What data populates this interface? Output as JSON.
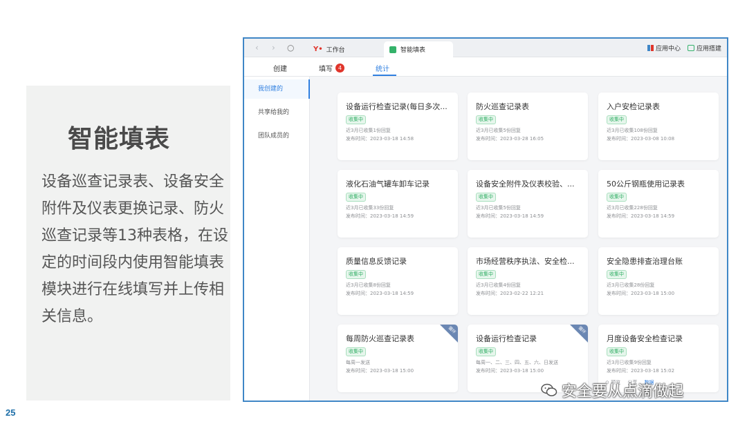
{
  "slide": {
    "title": "智能填表",
    "description": "设备巡查记录表、设备安全附件及仪表更换记录、防火巡查记录等13种表格，在设定的时间段内使用智能填表模块进行在线填写并上传相关信息。",
    "page_number": "25"
  },
  "window": {
    "nav": {
      "back": "‹",
      "forward": "›",
      "refresh": "○"
    },
    "tabs": [
      {
        "label": "工作台",
        "logo": "Y•"
      },
      {
        "label": "智能填表"
      }
    ],
    "app_center": "应用中心",
    "app_builder": "应用搭建"
  },
  "toolbar": {
    "create": "创建",
    "fill": "填写",
    "fill_badge": "4",
    "stats": "统计"
  },
  "sidebar": {
    "items": [
      "我创建的",
      "共享给我的",
      "团队成员的"
    ]
  },
  "cards": [
    {
      "title": "设备运行检查记录(每日多次...",
      "status": "收集中",
      "meta1": "近3月已收集1份回复",
      "meta2": "发布时间：2023-03-18 14:58"
    },
    {
      "title": "防火巡查记录表",
      "status": "收集中",
      "meta1": "近3月已收集5份回复",
      "meta2": "发布时间：2023-03-28 16:05"
    },
    {
      "title": "入户安检记录表",
      "status": "收集中",
      "meta1": "近3月已收集108份回复",
      "meta2": "发布时间：2023-03-08 10:08"
    },
    {
      "title": "液化石油气罐车卸车记录",
      "status": "收集中",
      "meta1": "近3月已收集33份回复",
      "meta2": "发布时间：2023-03-18 14:59"
    },
    {
      "title": "设备安全附件及仪表校验、...",
      "status": "收集中",
      "meta1": "近3月已收集5份回复",
      "meta2": "发布时间：2023-03-18 14:59"
    },
    {
      "title": "50公斤钢瓶使用记录表",
      "status": "收集中",
      "meta1": "近3月已收集228份回复",
      "meta2": "发布时间：2023-03-18 14:59"
    },
    {
      "title": "质量信息反馈记录",
      "status": "收集中",
      "meta1": "近3月已收集8份回复",
      "meta2": "发布时间：2023-03-18 14:59"
    },
    {
      "title": "市场经营秩序执法、安全检...",
      "status": "收集中",
      "meta1": "近3月已收集4份回复",
      "meta2": "发布时间：2023-02-22 12:21"
    },
    {
      "title": "安全隐患排查治理台账",
      "status": "收集中",
      "meta1": "近3月已收集28份回复",
      "meta2": "发布时间：2023-03-18 15:00"
    },
    {
      "title": "每周防火巡查记录表",
      "status": "收集中",
      "meta1": "每周一发送",
      "meta2": "发布时间：2023-03-18 15:00",
      "corner": "循环"
    },
    {
      "title": "设备运行检查记录",
      "status": "收集中",
      "meta1": "每周一、二、三、四、五、六、日发送",
      "meta2": "发布时间：2023-03-18 15:00",
      "corner": "循环"
    },
    {
      "title": "月度设备安全检查记录",
      "status": "收集中",
      "meta1": "近3月已收集9份回复",
      "meta2": "发布时间：2023-03-18 15:02",
      "actions": [
        "⊙ 预览",
        "分享",
        "数据",
        "..."
      ]
    }
  ],
  "watermark": "安全要从点滴做起",
  "colors": {
    "accent": "#2f7fe0",
    "frame": "#3f86c6",
    "status_green": "#2fae63",
    "badge_red": "#e0352b"
  }
}
